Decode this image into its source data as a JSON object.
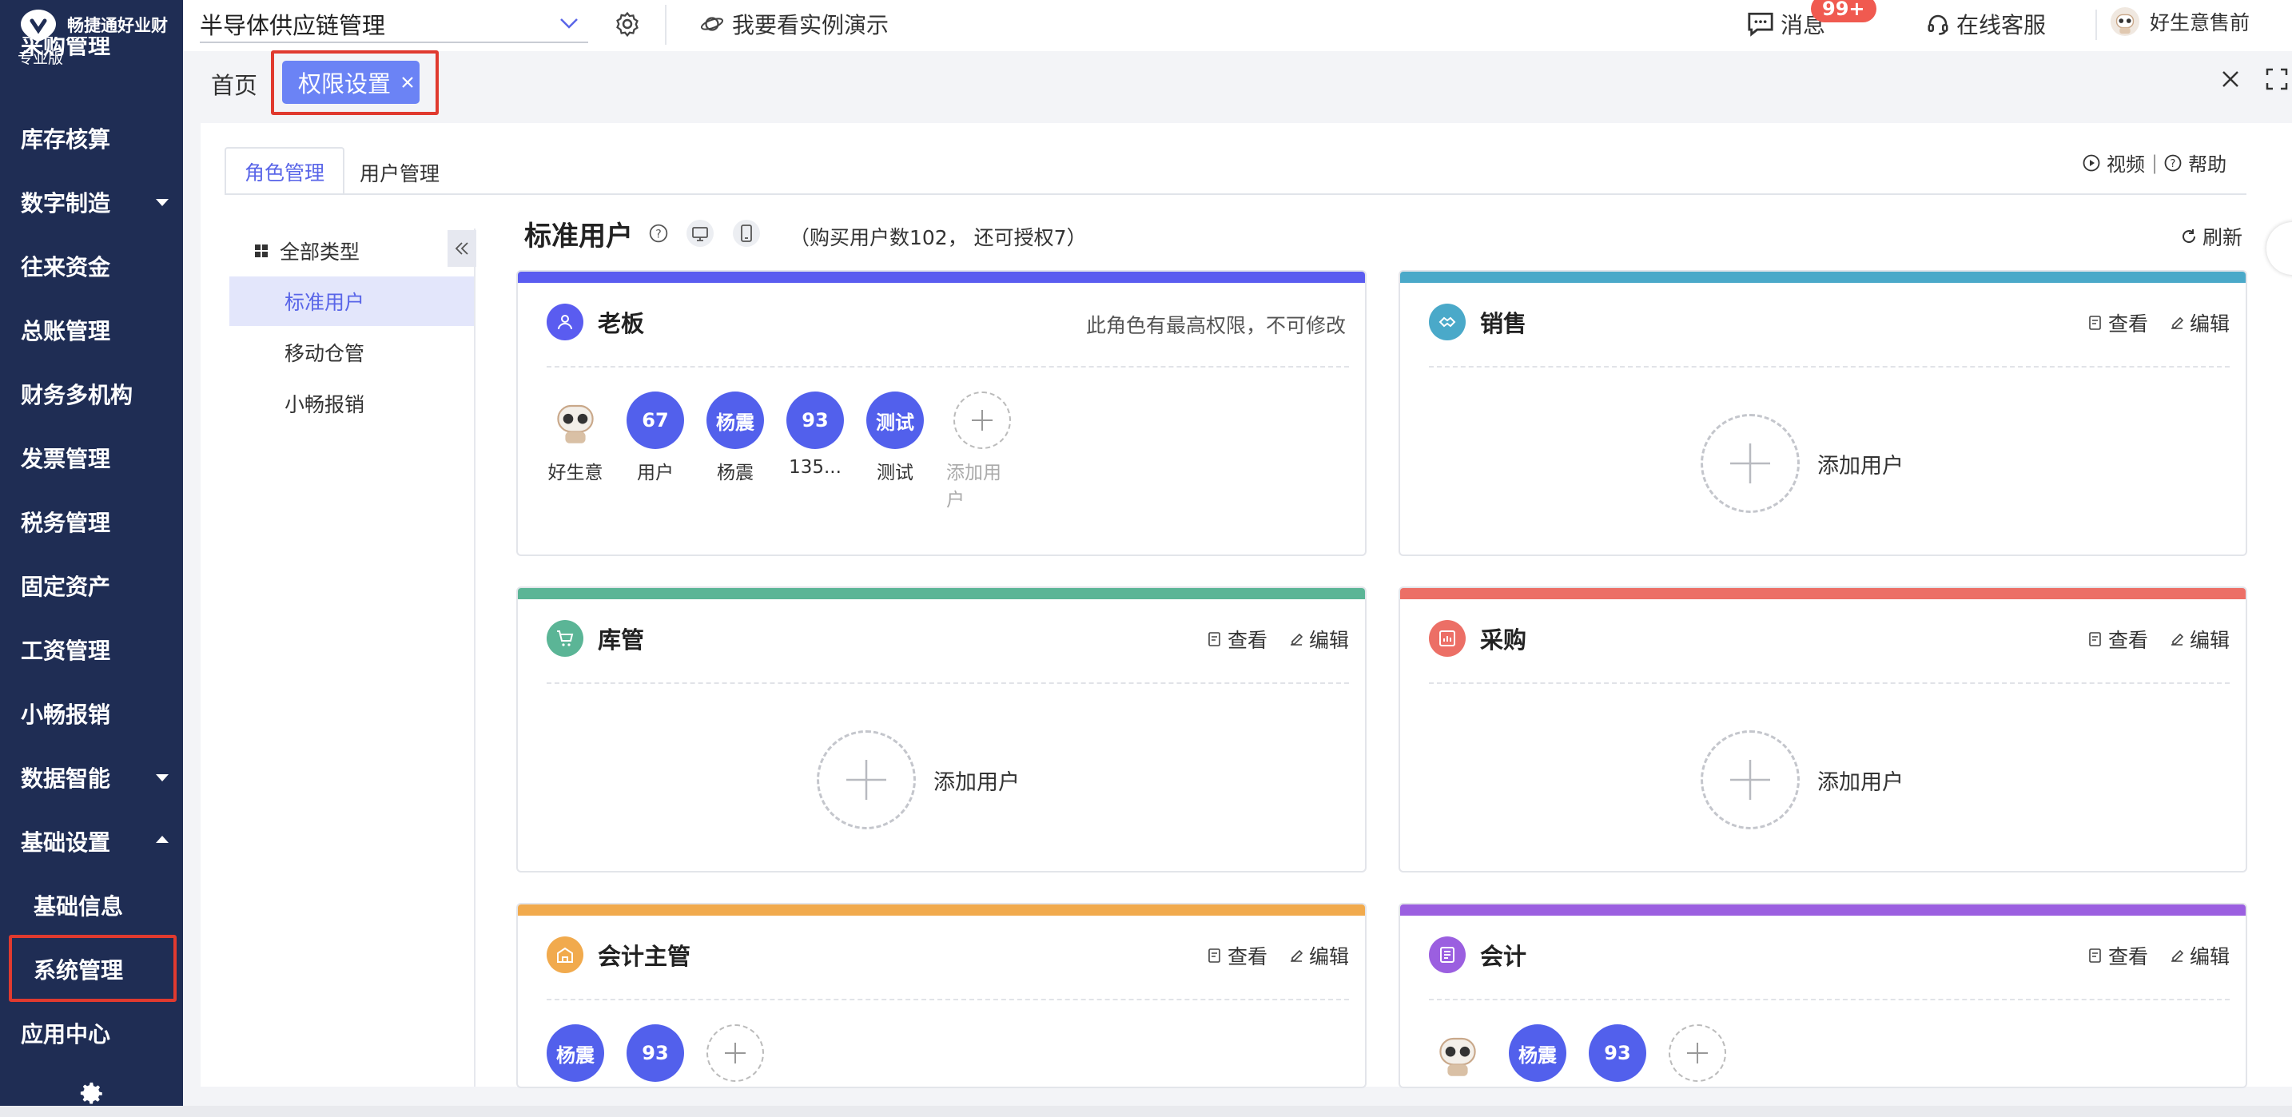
{
  "app": {
    "logo_text": "畅捷通好业财",
    "edition": "专业版"
  },
  "sidebar": {
    "items": [
      {
        "label": "采购管理"
      },
      {
        "label": "库存核算"
      },
      {
        "label": "数字制造"
      },
      {
        "label": "往来资金"
      },
      {
        "label": "总账管理"
      },
      {
        "label": "财务多机构"
      },
      {
        "label": "发票管理"
      },
      {
        "label": "税务管理"
      },
      {
        "label": "固定资产"
      },
      {
        "label": "工资管理"
      },
      {
        "label": "小畅报销"
      },
      {
        "label": "数据智能"
      },
      {
        "label": "基础设置"
      },
      {
        "label": "基础信息"
      },
      {
        "label": "系统管理"
      },
      {
        "label": "应用中心"
      }
    ]
  },
  "topbar": {
    "company": "半导体供应链管理",
    "demo": "我要看实例演示",
    "messages": "消息",
    "message_badge": "99+",
    "service": "在线客服",
    "user": "好生意售前"
  },
  "tabs": {
    "home": "首页",
    "active": "权限设置"
  },
  "content": {
    "subtabs": [
      "角色管理",
      "用户管理"
    ],
    "video": "视频",
    "help": "帮助",
    "left_panel": {
      "all": "全部类型",
      "items": [
        "标准用户",
        "移动仓管",
        "小畅报销"
      ]
    },
    "title": "标准用户",
    "tip": "（购买用户数102， 还可授权7）",
    "refresh": "刷新"
  },
  "cards": {
    "view": "查看",
    "edit": "编辑",
    "add_user": "添加用户",
    "boss": {
      "name": "老板",
      "note": "此角色有最高权限，不可修改",
      "color": "#5a5cf0",
      "members": [
        {
          "avatar": "",
          "label": "好生意"
        },
        {
          "avatar": "67",
          "label": "用户"
        },
        {
          "avatar": "杨震",
          "label": "杨震"
        },
        {
          "avatar": "93",
          "label": "135..."
        },
        {
          "avatar": "测试",
          "label": "测试"
        }
      ]
    },
    "sales": {
      "name": "销售",
      "color": "#4aa9c9"
    },
    "warehouse": {
      "name": "库管",
      "color": "#5bb596"
    },
    "purchase": {
      "name": "采购",
      "color": "#ec6f66"
    },
    "chief_accountant": {
      "name": "会计主管",
      "color": "#f1aa4d",
      "members": [
        "杨震",
        "93"
      ]
    },
    "accountant": {
      "name": "会计",
      "color": "#9b5fe0",
      "members": [
        "杨震",
        "93"
      ]
    }
  }
}
